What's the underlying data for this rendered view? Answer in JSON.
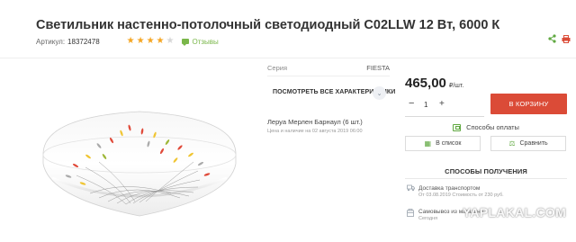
{
  "product": {
    "title": "Светильник настенно-потолочный светодиодный C02LLW 12 Вт, 6000 К",
    "sku_label": "Артикул:",
    "sku": "18372478",
    "rating": 4,
    "rating_max": 5,
    "reviews_label": "Отзывы"
  },
  "icons": {
    "share": "share-icon",
    "print": "printer-icon",
    "reviews": "chat-icon",
    "chevron": "chevron-down-icon",
    "payment": "card-icon",
    "list": "list-icon",
    "compare": "scales-icon",
    "delivery": "truck-icon",
    "pickup": "box-icon"
  },
  "specs": {
    "series_label": "Серия",
    "series_value": "FIESTA",
    "all_specs_label": "ПОСМОТРЕТЬ ВСЕ ХАРАКТЕРИСТИКИ"
  },
  "availability": {
    "store": "Леруа Мерлен Барнаул (6 шт.)",
    "note": "Цена и наличие на 02 августа 2019 06:00"
  },
  "purchase": {
    "price": "465,00",
    "unit": "₽/шт.",
    "qty_minus": "−",
    "quantity": "1",
    "qty_plus": "+",
    "buy_label": "В КОРЗИНУ",
    "payment_methods_label": "Способы оплаты",
    "add_to_list_label": "В список",
    "compare_label": "Сравнить"
  },
  "receiving": {
    "title": "СПОСОБЫ ПОЛУЧЕНИЯ",
    "delivery_title": "Доставка транспортом",
    "delivery_sub": "От 03.08.2019   Стоимость от 230 руб.",
    "pickup_title": "Самовывоз из магазина",
    "pickup_sub": "Сегодня"
  },
  "watermark": "YAPLAKAL.COM",
  "colors": {
    "accent_red": "#db4b37",
    "green": "#5fa840",
    "star": "#f5a623"
  }
}
